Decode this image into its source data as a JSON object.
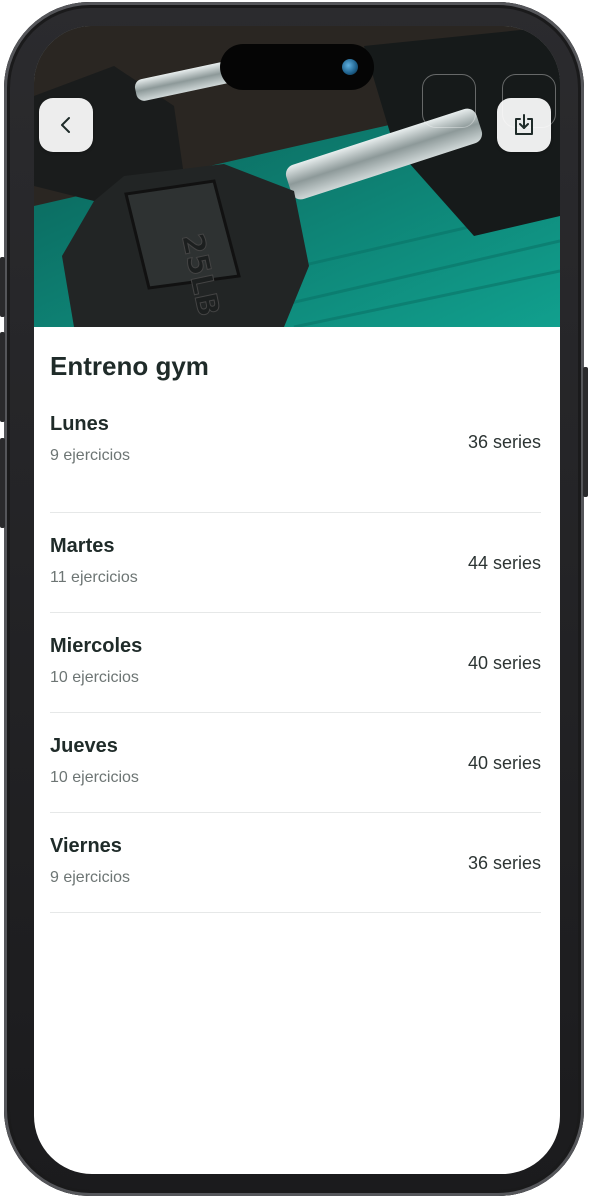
{
  "header": {
    "back_icon": "chevron-left-icon",
    "download_icon": "download-tray-icon"
  },
  "routine": {
    "title": "Entreno gym"
  },
  "days": [
    {
      "name": "Lunes",
      "exercises": "9 ejercicios",
      "series": "36 series"
    },
    {
      "name": "Martes",
      "exercises": "11 ejercicios",
      "series": "44 series"
    },
    {
      "name": "Miercoles",
      "exercises": "10 ejercicios",
      "series": "40 series"
    },
    {
      "name": "Jueves",
      "exercises": "10 ejercicios",
      "series": "40 series"
    },
    {
      "name": "Viernes",
      "exercises": "9 ejercicios",
      "series": "36 series"
    }
  ],
  "hero_image": {
    "dumbbell_label": "25LB"
  },
  "colors": {
    "title_text": "#1f2b29",
    "secondary_text": "#6d7574",
    "divider": "#e6e8e8",
    "mat_teal": "#0d8c7c"
  }
}
